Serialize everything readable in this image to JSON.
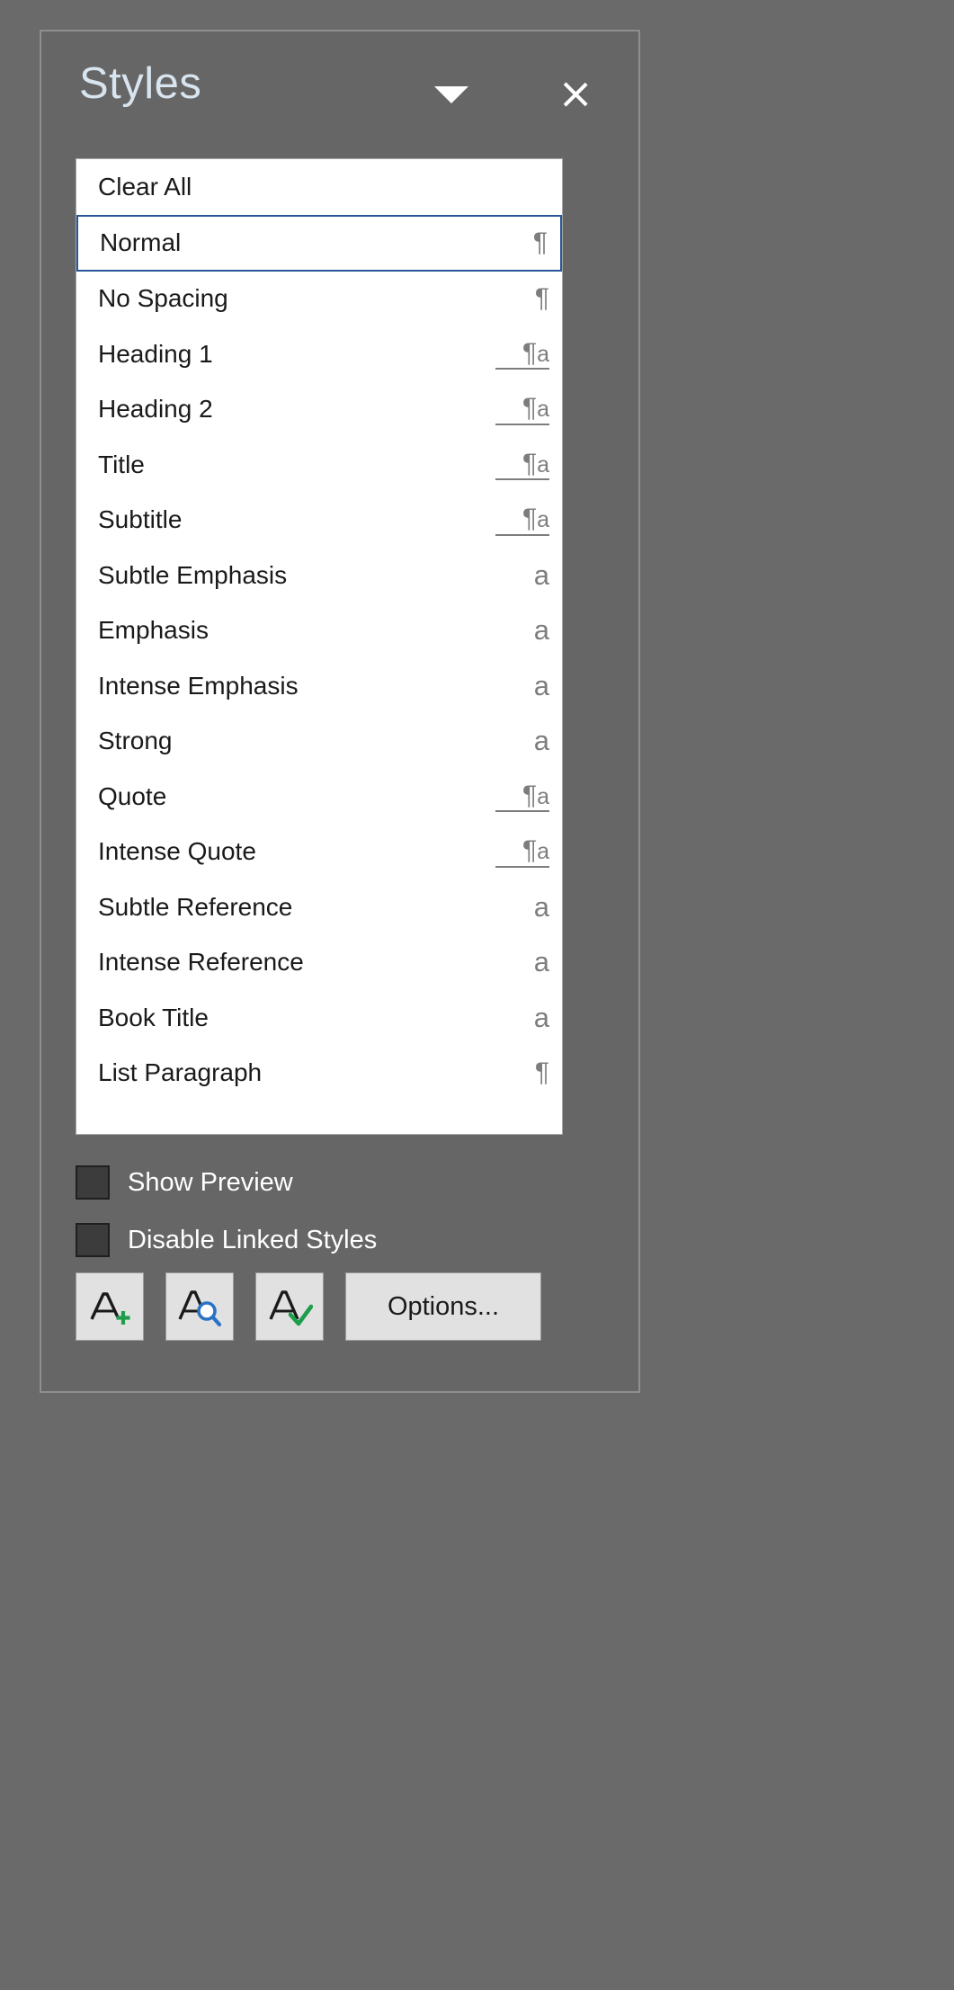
{
  "panel": {
    "title": "Styles",
    "dropdown_icon": "chevron-down-icon",
    "close_icon": "close-icon"
  },
  "styles_list": [
    {
      "label": "Clear All",
      "icon": "none",
      "selected": false
    },
    {
      "label": "Normal",
      "icon": "paragraph",
      "selected": true
    },
    {
      "label": "No Spacing",
      "icon": "paragraph",
      "selected": false
    },
    {
      "label": "Heading 1",
      "icon": "linked",
      "selected": false
    },
    {
      "label": "Heading 2",
      "icon": "linked",
      "selected": false
    },
    {
      "label": "Title",
      "icon": "linked",
      "selected": false
    },
    {
      "label": "Subtitle",
      "icon": "linked",
      "selected": false
    },
    {
      "label": "Subtle Emphasis",
      "icon": "character",
      "selected": false
    },
    {
      "label": "Emphasis",
      "icon": "character",
      "selected": false
    },
    {
      "label": "Intense Emphasis",
      "icon": "character",
      "selected": false
    },
    {
      "label": "Strong",
      "icon": "character",
      "selected": false
    },
    {
      "label": "Quote",
      "icon": "linked",
      "selected": false
    },
    {
      "label": "Intense Quote",
      "icon": "linked",
      "selected": false
    },
    {
      "label": "Subtle Reference",
      "icon": "character",
      "selected": false
    },
    {
      "label": "Intense Reference",
      "icon": "character",
      "selected": false
    },
    {
      "label": "Book Title",
      "icon": "character",
      "selected": false
    },
    {
      "label": "List Paragraph",
      "icon": "paragraph",
      "selected": false
    }
  ],
  "checkboxes": [
    {
      "label": "Show Preview",
      "checked": false
    },
    {
      "label": "Disable Linked Styles",
      "checked": false
    }
  ],
  "buttons": {
    "new_style": {
      "name": "new-style-button",
      "icon": "a-plus-icon"
    },
    "style_inspector": {
      "name": "style-inspector-button",
      "icon": "a-magnifier-icon"
    },
    "manage_styles": {
      "name": "manage-styles-button",
      "icon": "a-check-icon"
    },
    "options": "Options..."
  },
  "colors": {
    "panel_bg": "#666666",
    "list_bg": "#ffffff",
    "selection_border": "#2a5699",
    "title_text": "#d8e4ee",
    "icon_gray": "#7d7d7d",
    "accent_green": "#2e9e4f",
    "accent_blue": "#2a72c4"
  }
}
